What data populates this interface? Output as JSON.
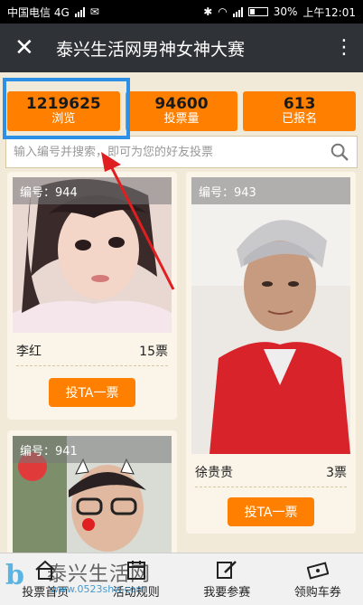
{
  "status_bar": {
    "carrier": "中国电信 4G",
    "battery": "30%",
    "time": "上午12:01"
  },
  "header": {
    "title": "泰兴生活网男神女神大赛"
  },
  "stats": [
    {
      "value": "1219625",
      "label": "浏览"
    },
    {
      "value": "94600",
      "label": "投票量"
    },
    {
      "value": "613",
      "label": "已报名"
    }
  ],
  "search": {
    "placeholder": "输入编号并搜索，即可为您的好友投票"
  },
  "contestants": [
    {
      "number": "编号：944",
      "name": "李红",
      "votes": "15票",
      "vote_label": "投TA一票"
    },
    {
      "number": "编号：943",
      "name": "徐贵贵",
      "votes": "3票",
      "vote_label": "投TA一票"
    },
    {
      "number": "编号：941"
    }
  ],
  "bottom_nav": [
    {
      "label": "投票首页",
      "icon": "home-icon"
    },
    {
      "label": "活动规则",
      "icon": "calendar-icon"
    },
    {
      "label": "我要参赛",
      "icon": "edit-icon"
    },
    {
      "label": "领购车券",
      "icon": "ticket-icon"
    }
  ],
  "watermark": {
    "logo_text": "b",
    "title": "泰兴生活网",
    "url": "www.0523shw.com"
  },
  "colors": {
    "accent": "#ff8000",
    "header_bg": "#2f3337",
    "highlight": "#2d8fe6",
    "arrow": "#e02020"
  }
}
